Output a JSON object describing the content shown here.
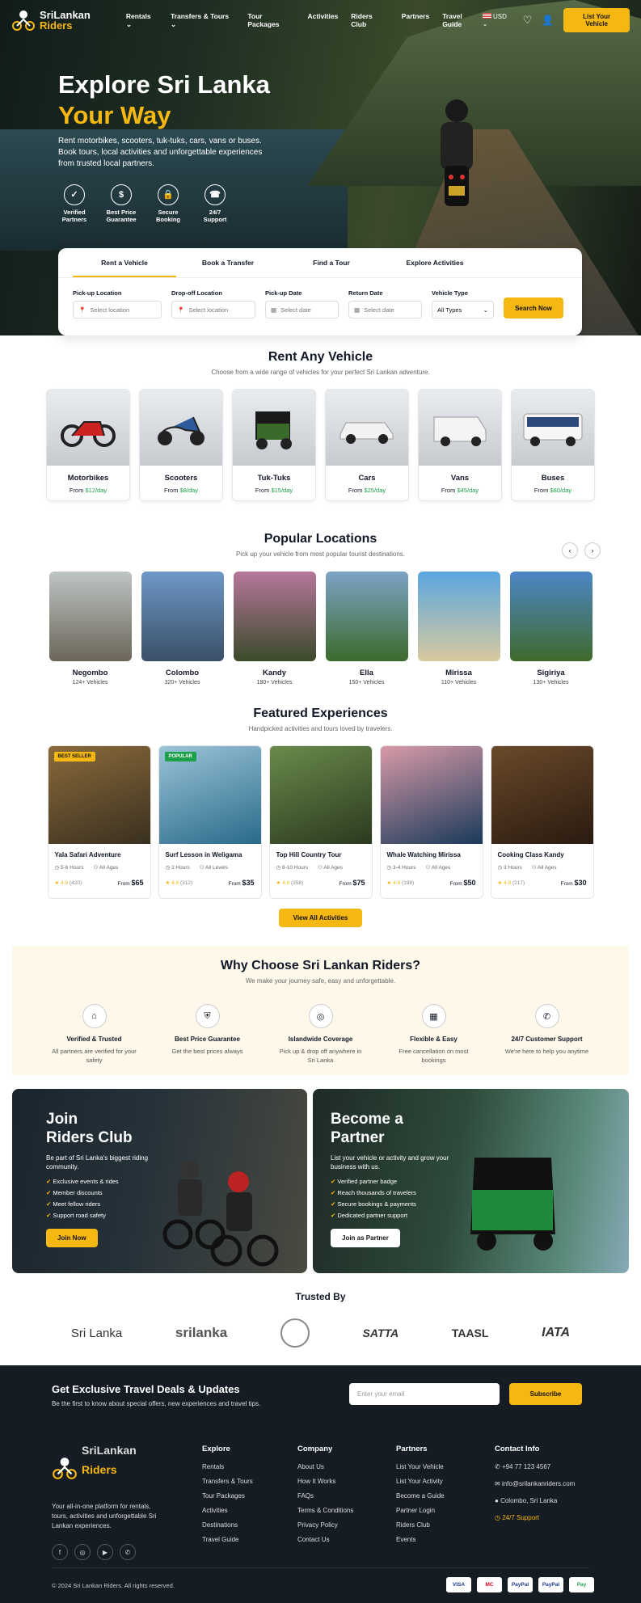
{
  "nav": {
    "logo_line1": "SriLankan",
    "logo_line2": "Riders",
    "menu": [
      "Rentals",
      "Transfers & Tours",
      "Tour Packages",
      "Activities",
      "Riders Club",
      "Partners",
      "Travel Guide"
    ],
    "currency": "USD",
    "cta": "List Your Vehicle"
  },
  "hero": {
    "title1": "Explore Sri Lanka",
    "title2": "Your Way",
    "subtitle": "Rent motorbikes, scooters, tuk-tuks, cars, vans or buses. Book tours, local activities and unforgettable experiences from trusted local partners.",
    "features": [
      {
        "icon": "shield-check-icon",
        "label": "Verified Partners"
      },
      {
        "icon": "price-tag-icon",
        "label": "Best Price Guarantee"
      },
      {
        "icon": "lock-icon",
        "label": "Secure Booking"
      },
      {
        "icon": "headset-icon",
        "label": "24/7 Support"
      }
    ]
  },
  "search": {
    "tabs": [
      "Rent a Vehicle",
      "Book a Transfer",
      "Find a Tour",
      "Explore Activities"
    ],
    "fields": {
      "pickup_label": "Pick-up Location",
      "pickup_placeholder": "Select location",
      "dropoff_label": "Drop-off Location",
      "dropoff_placeholder": "Select location",
      "pickup_date_label": "Pick-up Date",
      "pickup_date_placeholder": "Select date",
      "return_date_label": "Return Date",
      "return_date_placeholder": "Select date",
      "vehicle_label": "Vehicle Type",
      "vehicle_value": "All Types"
    },
    "button": "Search Now"
  },
  "vehicles": {
    "title": "Rent Any Vehicle",
    "subtitle": "Choose from a wide range of vehicles for your perfect Sri Lankan adventure.",
    "items": [
      {
        "name": "Motorbikes",
        "from": "From ",
        "price": "$12/day"
      },
      {
        "name": "Scooters",
        "from": "From ",
        "price": "$8/day"
      },
      {
        "name": "Tuk-Tuks",
        "from": "From ",
        "price": "$15/day"
      },
      {
        "name": "Cars",
        "from": "From ",
        "price": "$25/day"
      },
      {
        "name": "Vans",
        "from": "From ",
        "price": "$45/day"
      },
      {
        "name": "Buses",
        "from": "From ",
        "price": "$80/day"
      }
    ]
  },
  "locations": {
    "title": "Popular Locations",
    "subtitle": "Pick up your vehicle from most popular tourist destinations.",
    "items": [
      {
        "name": "Negombo",
        "count": "124+ Vehicles",
        "c1": "#bfc5c4",
        "c2": "#6b6659"
      },
      {
        "name": "Colombo",
        "count": "320+ Vehicles",
        "c1": "#6d98c7",
        "c2": "#3a4f68"
      },
      {
        "name": "Kandy",
        "count": "180+ Vehicles",
        "c1": "#b7779b",
        "c2": "#3a4a2a"
      },
      {
        "name": "Ella",
        "count": "150+ Vehicles",
        "c1": "#7ca3c7",
        "c2": "#3c6a2c"
      },
      {
        "name": "Mirissa",
        "count": "110+ Vehicles",
        "c1": "#5aa6e0",
        "c2": "#d8c99e"
      },
      {
        "name": "Sigiriya",
        "count": "130+ Vehicles",
        "c1": "#4d86c7",
        "c2": "#3f6a2c"
      }
    ]
  },
  "experiences": {
    "title": "Featured Experiences",
    "subtitle": "Handpicked activities and tours loved by travelers.",
    "items": [
      {
        "name": "Yala Safari Adventure",
        "duration": "5-6 Hours",
        "age": "All Ages",
        "rating": "4.9",
        "reviews": "(420)",
        "from": "From ",
        "price": "$65",
        "badge": "BEST SELLER",
        "c1": "#8a6a3a",
        "c2": "#3a3020"
      },
      {
        "name": "Surf Lesson in Weligama",
        "duration": "2 Hours",
        "age": "All Levels",
        "rating": "4.8",
        "reviews": "(312)",
        "from": "From ",
        "price": "$35",
        "badge": "POPULAR",
        "c1": "#9bc4d8",
        "c2": "#2a6a8a"
      },
      {
        "name": "Top Hill Country Tour",
        "duration": "8-10 Hours",
        "age": "All Ages",
        "rating": "4.9",
        "reviews": "(258)",
        "from": "From ",
        "price": "$75",
        "badge": "",
        "c1": "#6a8a4a",
        "c2": "#2a3a20"
      },
      {
        "name": "Whale Watching Mirissa",
        "duration": "3-4 Hours",
        "age": "All Ages",
        "rating": "4.9",
        "reviews": "(198)",
        "from": "From ",
        "price": "$50",
        "badge": "",
        "c1": "#d89aa8",
        "c2": "#1a3a5a"
      },
      {
        "name": "Cooking Class Kandy",
        "duration": "3 Hours",
        "age": "All Ages",
        "rating": "4.9",
        "reviews": "(217)",
        "from": "From ",
        "price": "$30",
        "badge": "",
        "c1": "#6a4a2a",
        "c2": "#2a1a10"
      }
    ],
    "button": "View All Activities"
  },
  "why": {
    "title": "Why Choose Sri Lankan Riders?",
    "subtitle": "We make your journey safe, easy and unforgettable.",
    "items": [
      {
        "icon": "house-check-icon",
        "title": "Verified & Trusted",
        "desc": "All partners are verified for your safety"
      },
      {
        "icon": "shield-icon",
        "title": "Best Price Guarantee",
        "desc": "Get the best prices always"
      },
      {
        "icon": "location-icon",
        "title": "Islandwide Coverage",
        "desc": "Pick up & drop off anywhere in Sri Lanka"
      },
      {
        "icon": "calendar-icon",
        "title": "Flexible & Easy",
        "desc": "Free cancellation on most bookings"
      },
      {
        "icon": "chat-support-icon",
        "title": "24/7 Customer Support",
        "desc": "We're here to help you anytime"
      }
    ]
  },
  "club": {
    "title1": "Join",
    "title2": "Riders Club",
    "desc": "Be part of Sri Lanka's biggest riding community.",
    "list": [
      "Exclusive events & rides",
      "Member discounts",
      "Meet fellow riders",
      "Support road safety"
    ],
    "button": "Join Now"
  },
  "partner": {
    "title1": "Become a",
    "title2": "Partner",
    "desc": "List your vehicle or activity and grow your business with us.",
    "list": [
      "Verified partner badge",
      "Reach thousands of travelers",
      "Secure bookings & payments",
      "Dedicated partner support"
    ],
    "button": "Join as Partner"
  },
  "trusted": {
    "title": "Trusted By",
    "logos": [
      "Sri Lanka",
      "srilanka",
      "SATTA",
      "TAASL",
      "IATA"
    ]
  },
  "newsletter": {
    "title": "Get Exclusive Travel Deals & Updates",
    "subtitle": "Be the first to know about special offers, new experiences and travel tips.",
    "placeholder": "Enter your email",
    "button": "Subscribe"
  },
  "footer": {
    "about": "Your all-in-one platform for rentals, tours, activities and unforgettable Sri Lankan experiences.",
    "explore_title": "Explore",
    "explore": [
      "Rentals",
      "Transfers & Tours",
      "Tour Packages",
      "Activities",
      "Destinations",
      "Travel Guide"
    ],
    "company_title": "Company",
    "company": [
      "About Us",
      "How It Works",
      "FAQs",
      "Terms & Conditions",
      "Privacy Policy",
      "Contact Us"
    ],
    "partners_title": "Partners",
    "partners": [
      "List Your Vehicle",
      "List Your Activity",
      "Become a Guide",
      "Partner Login",
      "Riders Club",
      "Events"
    ],
    "contact_title": "Contact Info",
    "phone": "+94 77 123 4567",
    "email": "info@srilankanriders.com",
    "address": "Colombo, Sri Lanka",
    "support": "24/7 Support",
    "copyright": "© 2024 Sri Lankan Riders. All rights reserved.",
    "payments": [
      "VISA",
      "MC",
      "PayPal",
      "PayPal",
      "Pay"
    ]
  },
  "colors": {
    "accent": "#f5b711",
    "dark": "#151c24",
    "green_price": "#1ea04b"
  }
}
